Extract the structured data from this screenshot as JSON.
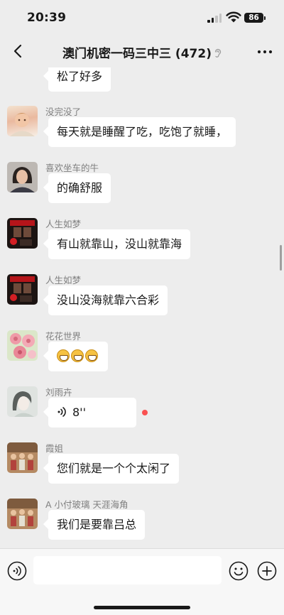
{
  "status_bar": {
    "time": "20:39",
    "battery": "86"
  },
  "nav": {
    "title": "澳门机密一码三中三 (472)",
    "icons": [
      "back-icon",
      "ear-icon",
      "more-icon"
    ]
  },
  "messages": [
    {
      "sender": "",
      "text": "松了好多"
    },
    {
      "sender": "没完没了",
      "text": "每天就是睡醒了吃，吃饱了就睡，"
    },
    {
      "sender": "喜欢坐车的牛",
      "text": "的确舒服"
    },
    {
      "sender": "人生如梦",
      "text": "有山就靠山，没山就靠海"
    },
    {
      "sender": "人生如梦",
      "text": "没山没海就靠六合彩"
    },
    {
      "sender": "花花世界",
      "emoji": [
        "grin-emoji",
        "grin-emoji",
        "grin-emoji"
      ]
    },
    {
      "sender": "刘雨卉",
      "voice_duration": "8''",
      "unread": true
    },
    {
      "sender": "霞姐",
      "text": "您们就是一个个太闲了"
    },
    {
      "sender": "A 小付玻璃 天涯海角",
      "text": "我们是要靠吕总"
    }
  ],
  "input_bar": {
    "icons": [
      "voice-icon",
      "emoji-icon",
      "plus-icon"
    ]
  },
  "colors": {
    "background": "#ededed",
    "bubble": "#ffffff",
    "unread_dot": "#fa5151",
    "input_bar": "#f7f7f7"
  }
}
